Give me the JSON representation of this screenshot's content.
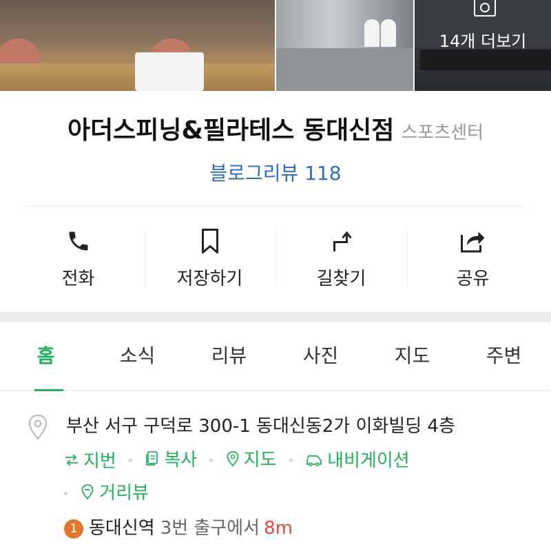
{
  "photos": {
    "more_label": "14개 더보기",
    "icons": [
      "camera-icon"
    ]
  },
  "place": {
    "name": "아더스피닝&필라테스 동대신점",
    "category": "스포츠센터",
    "blog_review_label": "블로그리뷰 118"
  },
  "actions": [
    {
      "label": "전화",
      "icon": "phone-icon"
    },
    {
      "label": "저장하기",
      "icon": "bookmark-icon"
    },
    {
      "label": "길찾기",
      "icon": "directions-icon"
    },
    {
      "label": "공유",
      "icon": "share-icon"
    }
  ],
  "tabs": [
    {
      "label": "홈",
      "active": true
    },
    {
      "label": "소식",
      "active": false
    },
    {
      "label": "리뷰",
      "active": false
    },
    {
      "label": "사진",
      "active": false
    },
    {
      "label": "지도",
      "active": false
    },
    {
      "label": "주변",
      "active": false
    }
  ],
  "info": {
    "address": "부산 서구 구덕로 300-1 동대신동2가 이화빌딩 4층",
    "links": [
      {
        "label": "지번",
        "icon": "swap-icon"
      },
      {
        "label": "복사",
        "icon": "copy-icon"
      },
      {
        "label": "지도",
        "icon": "map-pin-icon"
      },
      {
        "label": "내비게이션",
        "icon": "car-icon"
      },
      {
        "label": "거리뷰",
        "icon": "street-view-icon"
      }
    ],
    "subway": {
      "line": "1",
      "line_color": "#e6742b",
      "station": "동대신역",
      "exit": "3번 출구에서",
      "distance": "8m"
    }
  },
  "colors": {
    "accent_green": "#1eb35a",
    "review_blue": "#2a6ec0",
    "distance_red": "#e44a3a"
  }
}
